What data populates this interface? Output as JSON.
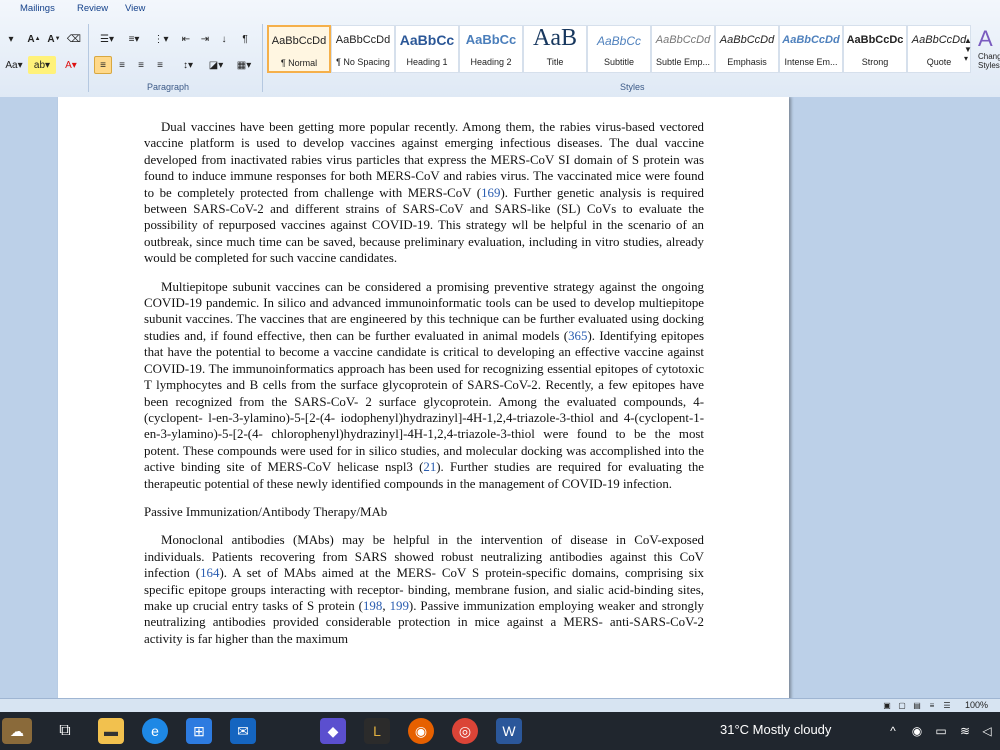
{
  "ribbon": {
    "tabs": [
      "Mailings",
      "Review",
      "View"
    ],
    "groups": {
      "paragraph": "Paragraph",
      "styles": "Styles"
    },
    "change_styles": "Change Styles",
    "styles": [
      {
        "sample": "AaBbCcDd",
        "name": "¶ Normal"
      },
      {
        "sample": "AaBbCcDd",
        "name": "¶ No Spacing"
      },
      {
        "sample": "AaBbCc",
        "name": "Heading 1"
      },
      {
        "sample": "AaBbCc",
        "name": "Heading 2"
      },
      {
        "sample": "AaB",
        "name": "Title"
      },
      {
        "sample": "AaBbCc",
        "name": "Subtitle"
      },
      {
        "sample": "AaBbCcDd",
        "name": "Subtle Emp..."
      },
      {
        "sample": "AaBbCcDd",
        "name": "Emphasis"
      },
      {
        "sample": "AaBbCcDd",
        "name": "Intense Em..."
      },
      {
        "sample": "AaBbCcDc",
        "name": "Strong"
      },
      {
        "sample": "AaBbCcDd",
        "name": "Quote"
      }
    ]
  },
  "document": {
    "p1": {
      "a": "Dual vaccines have been getting more popular recently. Among them, the rabies virus-based vectored vaccine platform is used to develop vaccines against emerging infectious diseases. The dual vaccine developed from inactivated rabies virus particles that express the MERS-CoV SI domain of S protein was found to induce immune responses for both MERS-CoV and rabies virus. The vaccinated mice were found to be completely protected from challenge with MERS-CoV (",
      "ref": "169",
      "b": "). Further genetic analysis is required between SARS-CoV-2 and different strains of SARS-CoV and SARS-like (SL) CoVs to evaluate the possibility of repurposed vaccines against COVID-19. This strategy wll be helpful in the scenario of an outbreak, since much time can be saved, because preliminary evaluation, including in vitro studies, already would be completed for such vaccine candidates."
    },
    "p2": {
      "a": "Multiepitope subunit vaccines can be considered a promising preventive strategy against the ongoing COVID-19 pandemic. In silico and advanced immunoinformatic tools can be used to develop multiepitope subunit vaccines. The vaccines that are engineered by this technique can be further evaluated using docking studies and, if found effective, then can be further evaluated in animal models (",
      "ref1": "365",
      "b": "). Identifying epitopes that have the potential to become a vaccine candidate is critical to developing an effective vaccine against COVID-19. The immunoinformatics approach has been used for recognizing essential epitopes of cytotoxic T lymphocytes and B cells from the surface glycoprotein of SARS-CoV-2. Recently, a few epitopes have been recognized from the SARS-CoV- 2 surface glycoprotein. Among the evaluated compounds, 4-(cyclopent- l-en-3-ylamino)-5-[2-(4- iodophenyl)hydrazinyl]-4H-1,2,4-triazole-3-thiol and 4-(cyclopent-1-en-3-ylamino)-5-[2-(4- chlorophenyl)hydrazinyl]-4H-1,2,4-triazole-3-thiol were found to be the most potent. These compounds were used for in silico studies, and molecular docking was accomplished into the active binding site of MERS-CoV helicase nspl3 (",
      "ref2": "21",
      "c": "). Further studies are required for evaluating the therapeutic potential of these newly identified compounds in the management of COVID-19 infection."
    },
    "heading": "Passive Immunization/Antibody Therapy/MAb",
    "p3": {
      "a": "Monoclonal antibodies (MAbs) may be helpful in the intervention of disease in CoV-exposed individuals. Patients recovering from SARS showed robust neutralizing antibodies against this CoV infection (",
      "ref1": "164",
      "b": "). A set of MAbs aimed at the MERS- CoV S protein-specific domains, comprising six specific epitope groups interacting with receptor- binding, membrane fusion, and sialic acid-binding sites, make up crucial entry tasks of S protein (",
      "ref2": "198",
      "sep": ", ",
      "ref3": "199",
      "c": "). Passive immunization employing weaker and strongly neutralizing antibodies provided considerable protection in mice against a MERS- anti-SARS-CoV-2 activity is far higher than the maximum"
    }
  },
  "statusbar": {
    "zoom": "100%"
  },
  "taskbar": {
    "weather": "31°C  Mostly cloudy"
  }
}
